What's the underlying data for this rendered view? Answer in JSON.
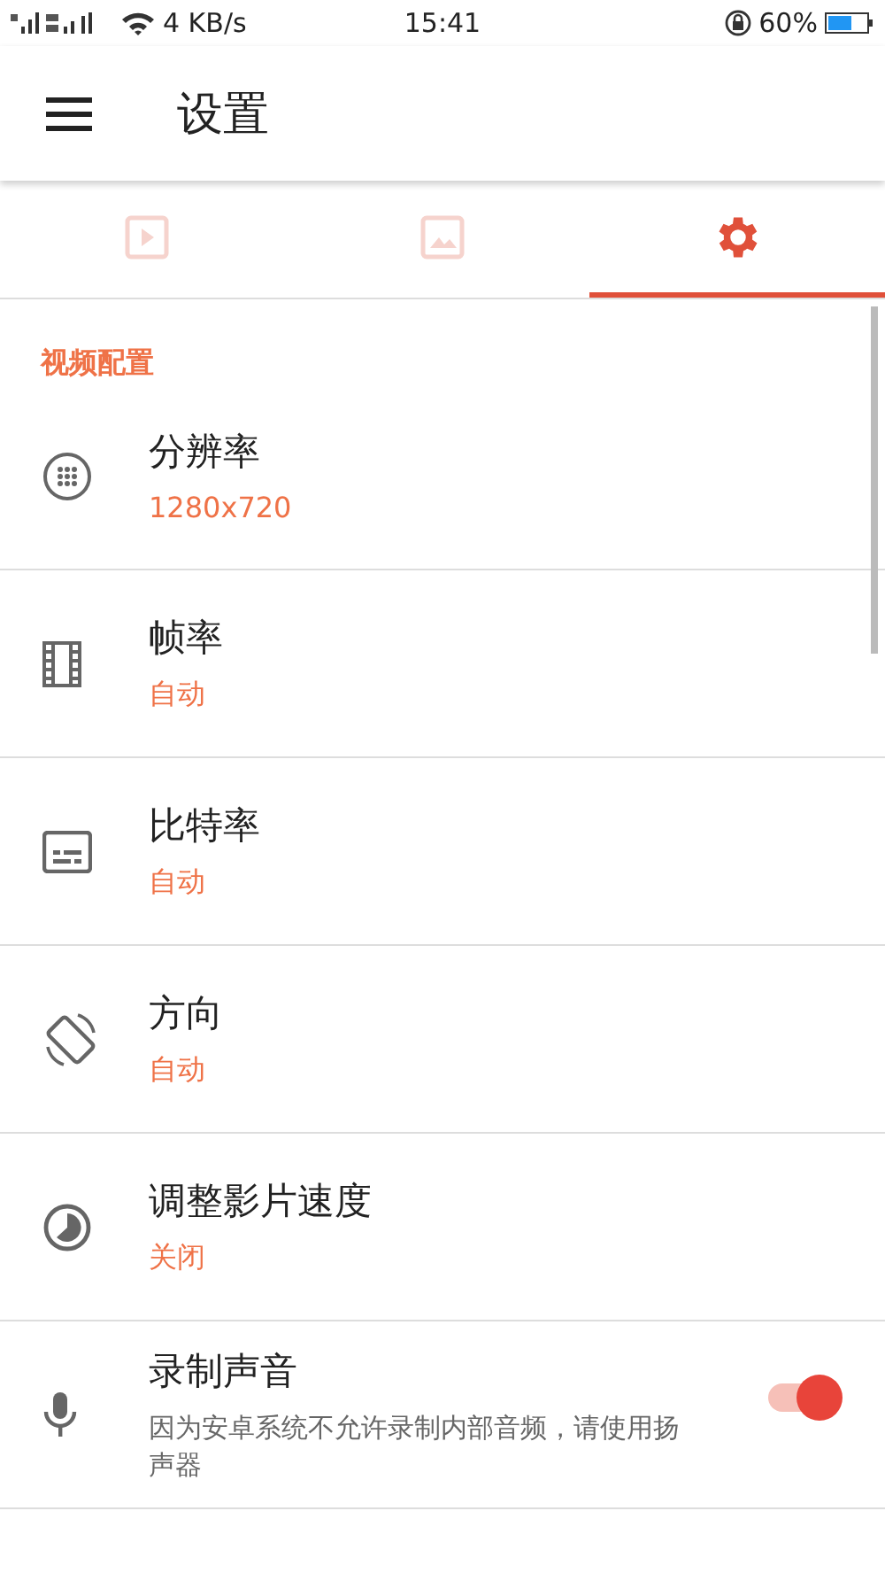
{
  "status_bar": {
    "speed": "4 KB/s",
    "time": "15:41",
    "battery": "60%"
  },
  "app_bar": {
    "title": "设置"
  },
  "tabs": [
    {
      "selected": false
    },
    {
      "selected": false
    },
    {
      "selected": true
    }
  ],
  "section": {
    "title": "视频配置"
  },
  "rows": [
    {
      "kind": "value",
      "title": "分辨率",
      "value": "1280x720"
    },
    {
      "kind": "value",
      "title": "帧率",
      "value": "自动"
    },
    {
      "kind": "value",
      "title": "比特率",
      "value": "自动"
    },
    {
      "kind": "value",
      "title": "方向",
      "value": "自动"
    },
    {
      "kind": "value",
      "title": "调整影片速度",
      "value": "关闭"
    },
    {
      "kind": "switch",
      "title": "录制声音",
      "description": "因为安卓系统不允许录制内部音频，请使用扬声器",
      "on": true
    }
  ]
}
